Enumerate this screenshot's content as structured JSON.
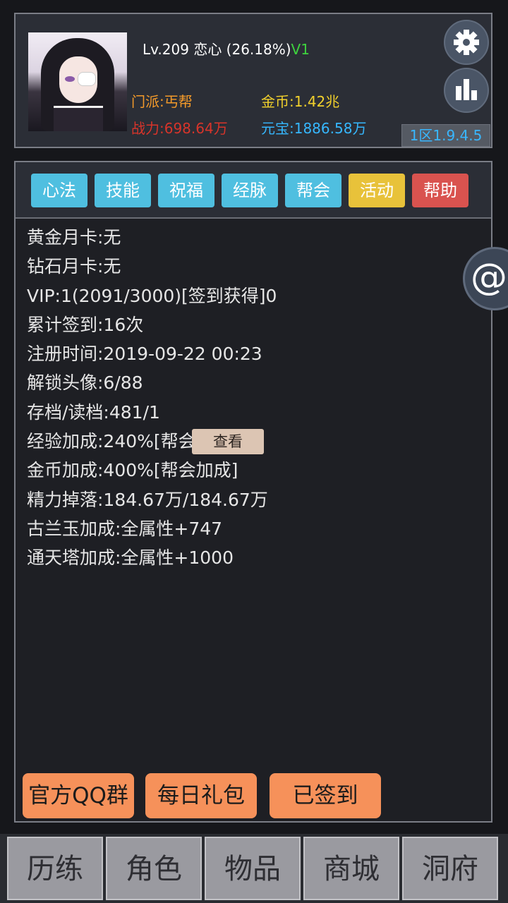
{
  "profile": {
    "level_text": "Lv.209 恋心 (26.18%)",
    "vip_badge": "V1",
    "sect": "门派:丐帮",
    "gold": "金币:1.42兆",
    "power": "战力:698.64万",
    "yuanbao": "元宝:1886.58万",
    "server_version": "1区1.9.4.5"
  },
  "tabs": [
    {
      "label": "心法",
      "color": "#4fbfe0"
    },
    {
      "label": "技能",
      "color": "#4fbfe0"
    },
    {
      "label": "祝福",
      "color": "#4fbfe0"
    },
    {
      "label": "经脉",
      "color": "#4fbfe0"
    },
    {
      "label": "帮会",
      "color": "#4fbfe0"
    },
    {
      "label": "活动",
      "color": "#e8c23a"
    },
    {
      "label": "帮助",
      "color": "#d9534f"
    }
  ],
  "info": [
    "黄金月卡:无",
    "钻石月卡:无",
    "VIP:1(2091/3000)[签到获得]0",
    "累计签到:16次",
    "注册时间:2019-09-22 00:23",
    "解锁头像:6/88",
    "存档/读档:481/1",
    "经验加成:240%[帮会加成]",
    "金币加成:400%[帮会加成]",
    "精力掉落:184.67万/184.67万",
    "古兰玉加成:全属性+747",
    "通天塔加成:全属性+1000"
  ],
  "view_button": "查看",
  "actions": [
    "官方QQ群",
    "每日礼包",
    "已签到"
  ],
  "float_button": "@",
  "bottom_nav": [
    "历练",
    "角色",
    "物品",
    "商城",
    "洞府"
  ],
  "colors": {
    "orange_text": "#f39a2a",
    "red_text": "#d8342a",
    "yellow_text": "#f2d12c",
    "cyan_text": "#36b8ff",
    "vip_green": "#3ed23e"
  }
}
